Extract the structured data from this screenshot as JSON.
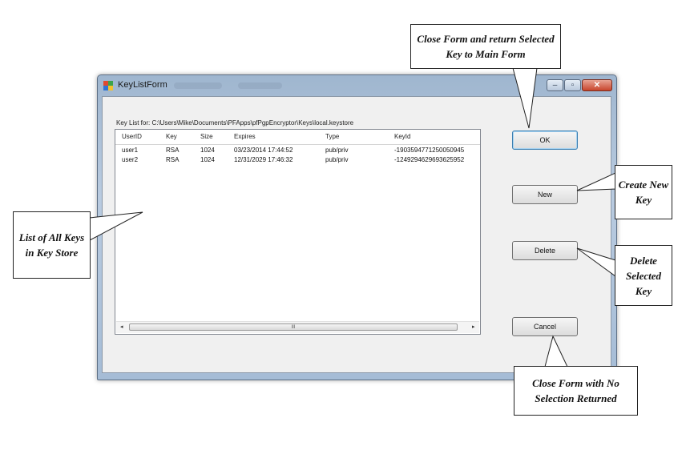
{
  "window": {
    "title": "KeyListForm"
  },
  "form": {
    "path_label": "Key List for: C:\\Users\\Mike\\Documents\\PFApps\\pfPgpEncryptor\\Keys\\local.keystore",
    "columns": [
      "UserID",
      "Key",
      "Size",
      "Expires",
      "Type",
      "KeyId"
    ],
    "rows": [
      [
        "user1",
        "RSA",
        "1024",
        "03/23/2014 17:44:52",
        "pub/priv",
        "-1903594771250050945"
      ],
      [
        "user2",
        "RSA",
        "1024",
        "12/31/2029 17:46:32",
        "pub/priv",
        "-1249294629693625952"
      ]
    ],
    "scroll_left": "◂",
    "scroll_right": "▸",
    "scroll_grip": "III",
    "buttons": {
      "ok": "OK",
      "new": "New",
      "delete": "Delete",
      "cancel": "Cancel"
    }
  },
  "callouts": {
    "ok": "Close Form and return Selected Key to Main Form",
    "new": "Create New Key",
    "delete": "Delete Selected Key",
    "cancel": "Close Form with No Selection Returned",
    "list": "List of All Keys in Key Store"
  },
  "window_controls": {
    "minimize": "–",
    "maximize": "▫",
    "close": "✕"
  }
}
